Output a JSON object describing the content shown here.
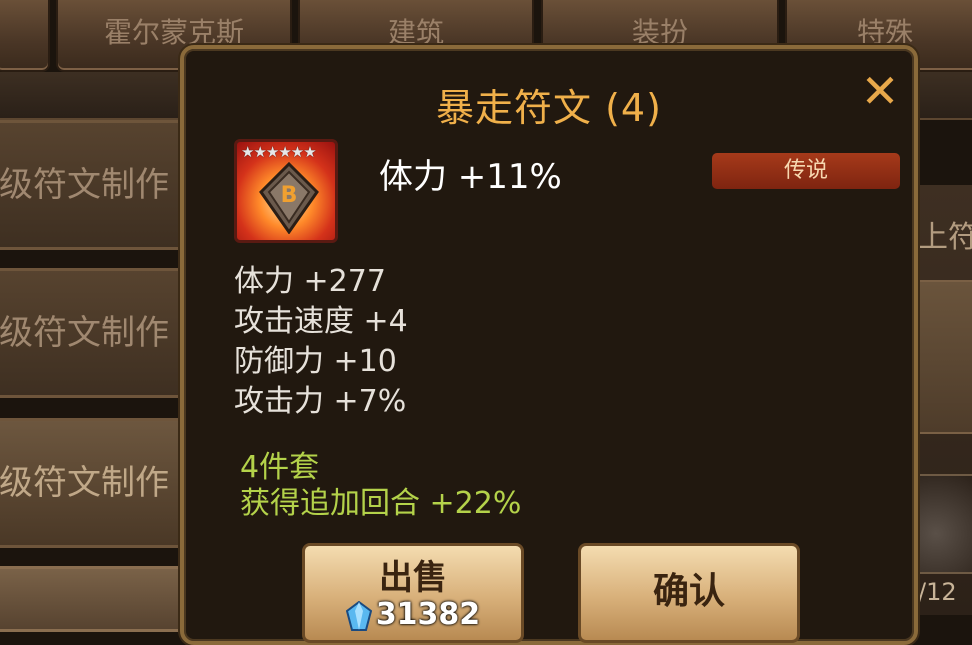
{
  "tabs": [
    {
      "label": ""
    },
    {
      "label": "霍尔蒙克斯"
    },
    {
      "label": "建筑"
    },
    {
      "label": "装扮"
    },
    {
      "label": "特殊"
    }
  ],
  "craft_list": {
    "items": [
      {
        "label": "级符文制作"
      },
      {
        "label": "级符文制作"
      },
      {
        "label": "级符文制作"
      }
    ]
  },
  "right_side": {
    "label": "上符",
    "count": "/12"
  },
  "dialog": {
    "title": "暴走符文 (4)",
    "close_icon": "close-x-icon",
    "rune": {
      "stars": "★★★★★★",
      "slot_letter": "B",
      "main_stat": "体力 +11%",
      "grade": "传说"
    },
    "sub_stats": [
      "体力 +277",
      "攻击速度 +4",
      "防御力 +10",
      "攻击力 +7%"
    ],
    "set_bonus": {
      "name": "4件套",
      "effect": "获得追加回合 +22%"
    },
    "sell_button": {
      "label": "出售",
      "price": "31382",
      "icon": "crystal-icon"
    },
    "confirm_button": {
      "label": "确认"
    }
  },
  "colors": {
    "title": "#f0b04a",
    "grade_badge": "#a63a1a",
    "set_text": "#b4d24a"
  }
}
